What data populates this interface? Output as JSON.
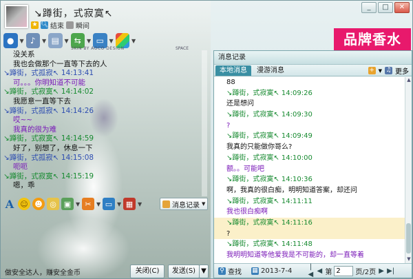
{
  "window": {
    "contact_name": "↘蹲街，式寂寞↖",
    "status_text": "结束",
    "status_text2": "瞬间",
    "controls": [
      "_",
      "□",
      "✕"
    ]
  },
  "brand": {
    "label": "品牌香水",
    "color": "#e8196c"
  },
  "toolbar": {
    "skin_text": "SKIN BY AOCO DESIGN",
    "space_text": "SPACE"
  },
  "chat": {
    "lines": [
      {
        "kind": "msg",
        "text": "没关系"
      },
      {
        "kind": "msg",
        "text": "我也会做那个一直等下去的人"
      },
      {
        "kind": "hdr_me",
        "text": "↘蹲街，式孤寂↖  14:13:41"
      },
      {
        "kind": "msg_purple",
        "text": "可。。。你明知道不可能"
      },
      {
        "kind": "hdr",
        "text": "↘蹲街，式寂寞↖  14:14:02"
      },
      {
        "kind": "msg",
        "text": "我愿意一直等下去"
      },
      {
        "kind": "hdr_me",
        "text": "↘蹲街，式孤寂↖  14:14:26"
      },
      {
        "kind": "msg_purple",
        "text": "哎~~"
      },
      {
        "kind": "msg_purple",
        "text": "我真的很为难"
      },
      {
        "kind": "hdr",
        "text": "↘蹲街，式寂寞↖  14:14:59"
      },
      {
        "kind": "msg",
        "text": "好了，别想了，休息一下"
      },
      {
        "kind": "hdr_me",
        "text": "↘蹲街，式孤寂↖  14:15:08"
      },
      {
        "kind": "msg_purple",
        "text": "呃呃"
      },
      {
        "kind": "hdr",
        "text": "↘蹲街，式寂寞↖  14:15:19"
      },
      {
        "kind": "msg",
        "text": "嗯，乖"
      }
    ]
  },
  "input_toolbar": {
    "font_icon": "A",
    "history_label": "消息记录"
  },
  "bottom": {
    "ad_text": "做安全达人，赚安全金币",
    "close_label": "关闭(C)",
    "send_label": "发送(S)"
  },
  "history": {
    "title": "消息记录",
    "tabs": [
      "本地消息",
      "漫游消息"
    ],
    "more_label": "更多",
    "rows": [
      {
        "kind": "msg",
        "text": "88"
      },
      {
        "kind": "hdr",
        "text": "↘蹲街，式寂寞↖  14:09:26"
      },
      {
        "kind": "msg",
        "text": "还是想问"
      },
      {
        "kind": "hdr",
        "text": "↘蹲街，式寂寞↖  14:09:30"
      },
      {
        "kind": "msg_purple",
        "text": "?"
      },
      {
        "kind": "hdr",
        "text": "↘蹲街，式寂寞↖  14:09:49"
      },
      {
        "kind": "msg",
        "text": "我真的只能做你哥么?"
      },
      {
        "kind": "hdr",
        "text": "↘蹲街，式寂寞↖  14:10:00"
      },
      {
        "kind": "msg_purple",
        "text": "额。。可能吧"
      },
      {
        "kind": "hdr",
        "text": "↘蹲街，式寂寞↖  14:10:36"
      },
      {
        "kind": "msg",
        "text": "啊，我真的很白痴，明明知道答案，却还问"
      },
      {
        "kind": "hdr",
        "text": "↘蹲街，式寂寞↖  14:11:11"
      },
      {
        "kind": "msg_purple",
        "text": "我也很白痴啊"
      },
      {
        "kind": "hdr_hl",
        "text": "↘蹲街，式寂寞↖  14:11:16"
      },
      {
        "kind": "msg_hl",
        "text": "?"
      },
      {
        "kind": "hdr",
        "text": "↘蹲街，式寂寞↖  14:11:48"
      },
      {
        "kind": "msg_purple",
        "text": "我明明知道等他爱我是不可能的，却一直等着"
      }
    ],
    "footer": {
      "find_label": "查找",
      "date": "2013-7-4",
      "page_prefix": "第",
      "page_value": "2",
      "page_suffix": "页/2页"
    }
  }
}
